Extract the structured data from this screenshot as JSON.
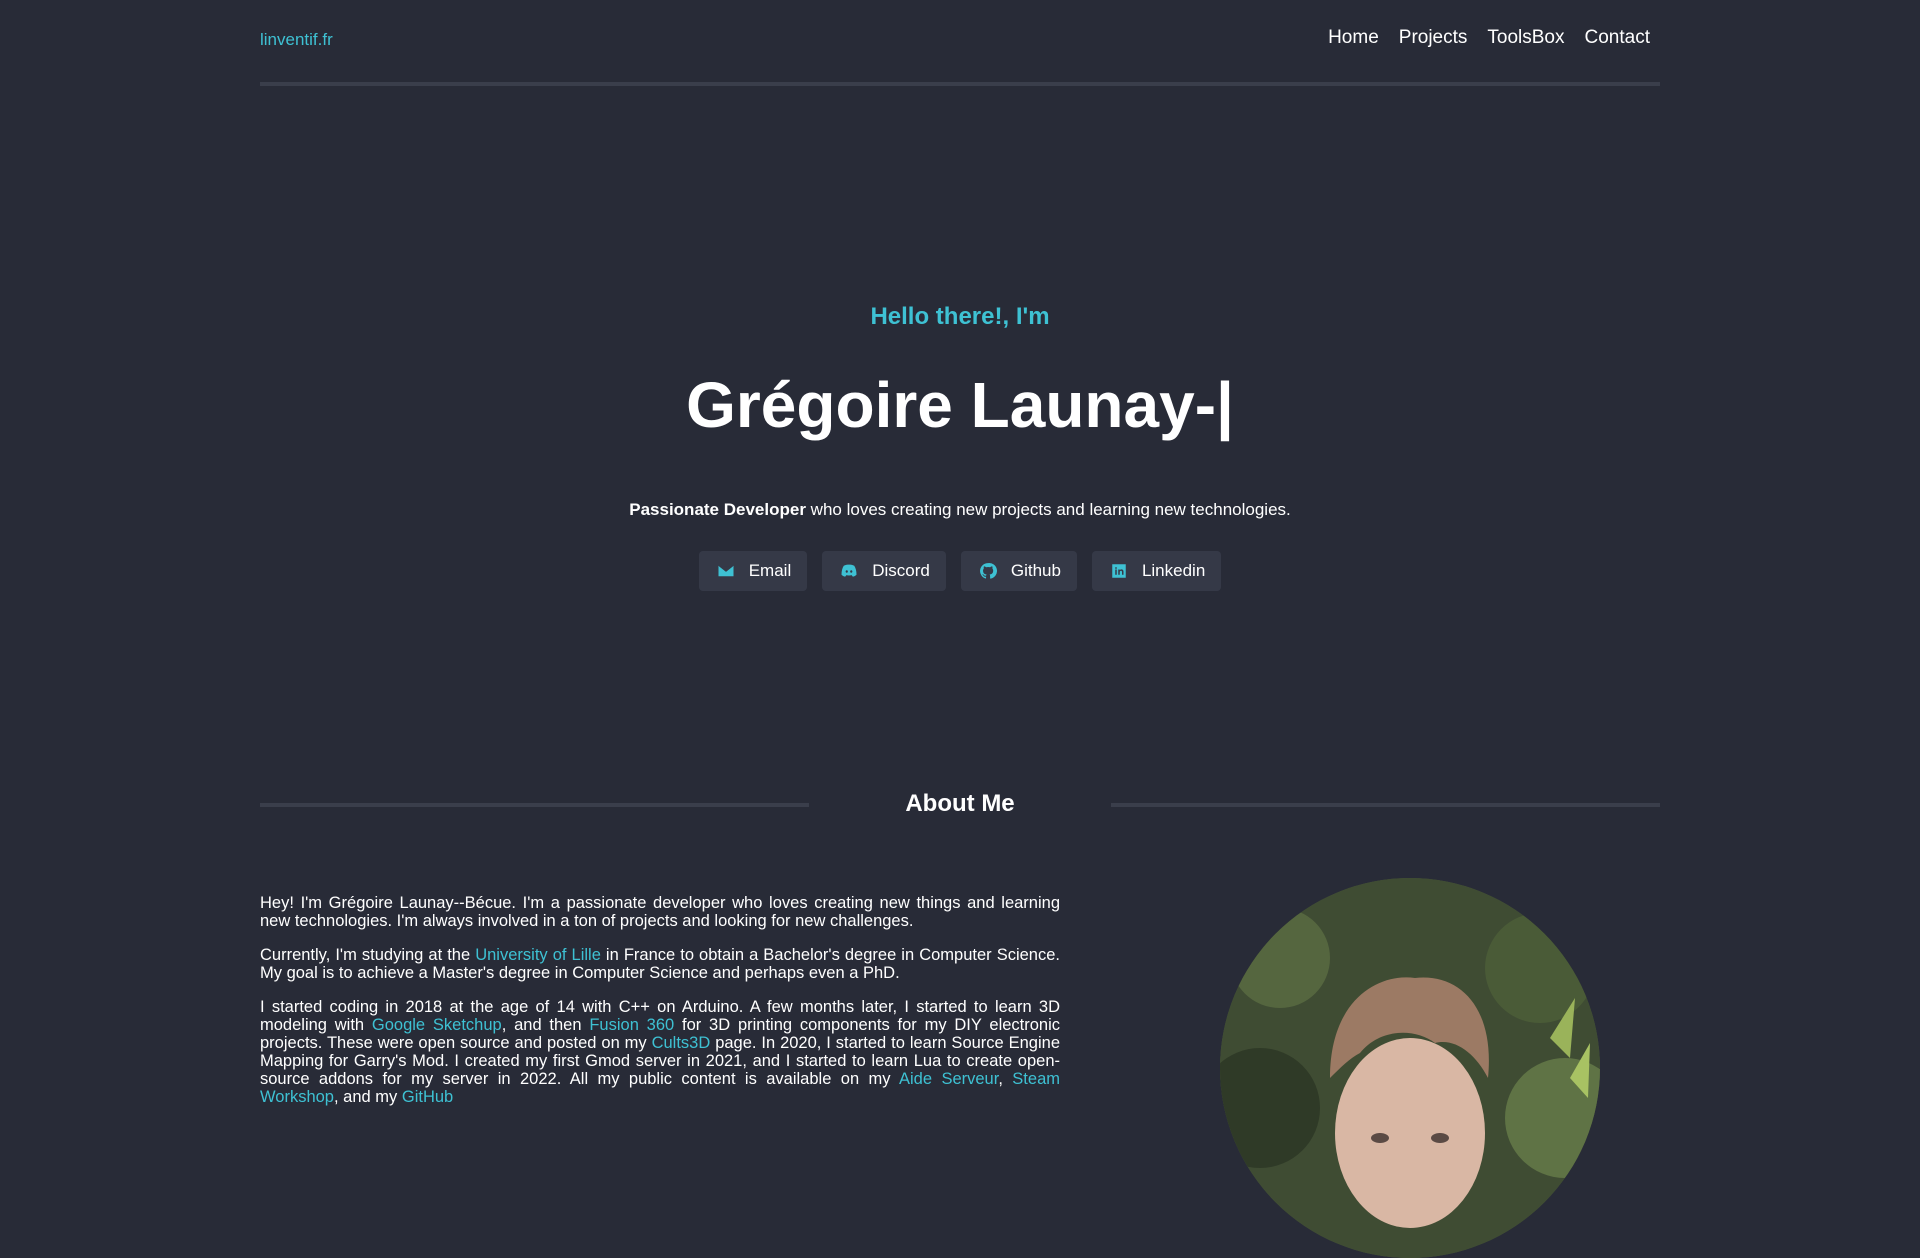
{
  "header": {
    "brand": "linventif.fr",
    "nav": [
      "Home",
      "Projects",
      "ToolsBox",
      "Contact"
    ]
  },
  "hero": {
    "greeting": "Hello there!, I'm",
    "name": "Grégoire Launay-|",
    "tagline_bold": "Passionate Developer",
    "tagline_rest": " who loves creating new projects and learning new technologies.",
    "socials": [
      {
        "label": "Email",
        "icon": "envelope-icon"
      },
      {
        "label": "Discord",
        "icon": "discord-icon"
      },
      {
        "label": "Github",
        "icon": "github-icon"
      },
      {
        "label": "Linkedin",
        "icon": "linkedin-icon"
      }
    ]
  },
  "about": {
    "title": "About Me",
    "p1": "Hey! I'm Grégoire Launay--Bécue. I'm a passionate developer who loves creating new things and learning new technologies. I'm always involved in a ton of projects and looking for new challenges.",
    "p2_a": "Currently, I'm studying at the ",
    "p2_link": "University of Lille",
    "p2_b": " in France to obtain a Bachelor's degree in Computer Science. My goal is to achieve a Master's degree in Computer Science and perhaps even a PhD.",
    "p3_a": "I started coding in 2018 at the age of 14 with C++ on Arduino. A few months later, I started to learn 3D modeling with ",
    "p3_link1": "Google Sketchup",
    "p3_b": ", and then ",
    "p3_link2": "Fusion 360",
    "p3_c": " for 3D printing components for my DIY electronic projects. These were open source and posted on my ",
    "p3_link3": "Cults3D",
    "p3_d": " page. In 2020, I started to learn Source Engine Mapping for Garry's Mod. I created my first Gmod server in 2021, and I started to learn Lua to create open-source addons for my server in 2022. All my public content is available on my ",
    "p3_link4": "Aide Serveur",
    "p3_e": ", ",
    "p3_link5": "Steam Workshop",
    "p3_f": ", and my ",
    "p3_link6": "GitHub"
  },
  "colors": {
    "background": "#282b37",
    "accent": "#3ec1d3",
    "button_bg": "#353947",
    "divider": "#3a3e4b"
  }
}
